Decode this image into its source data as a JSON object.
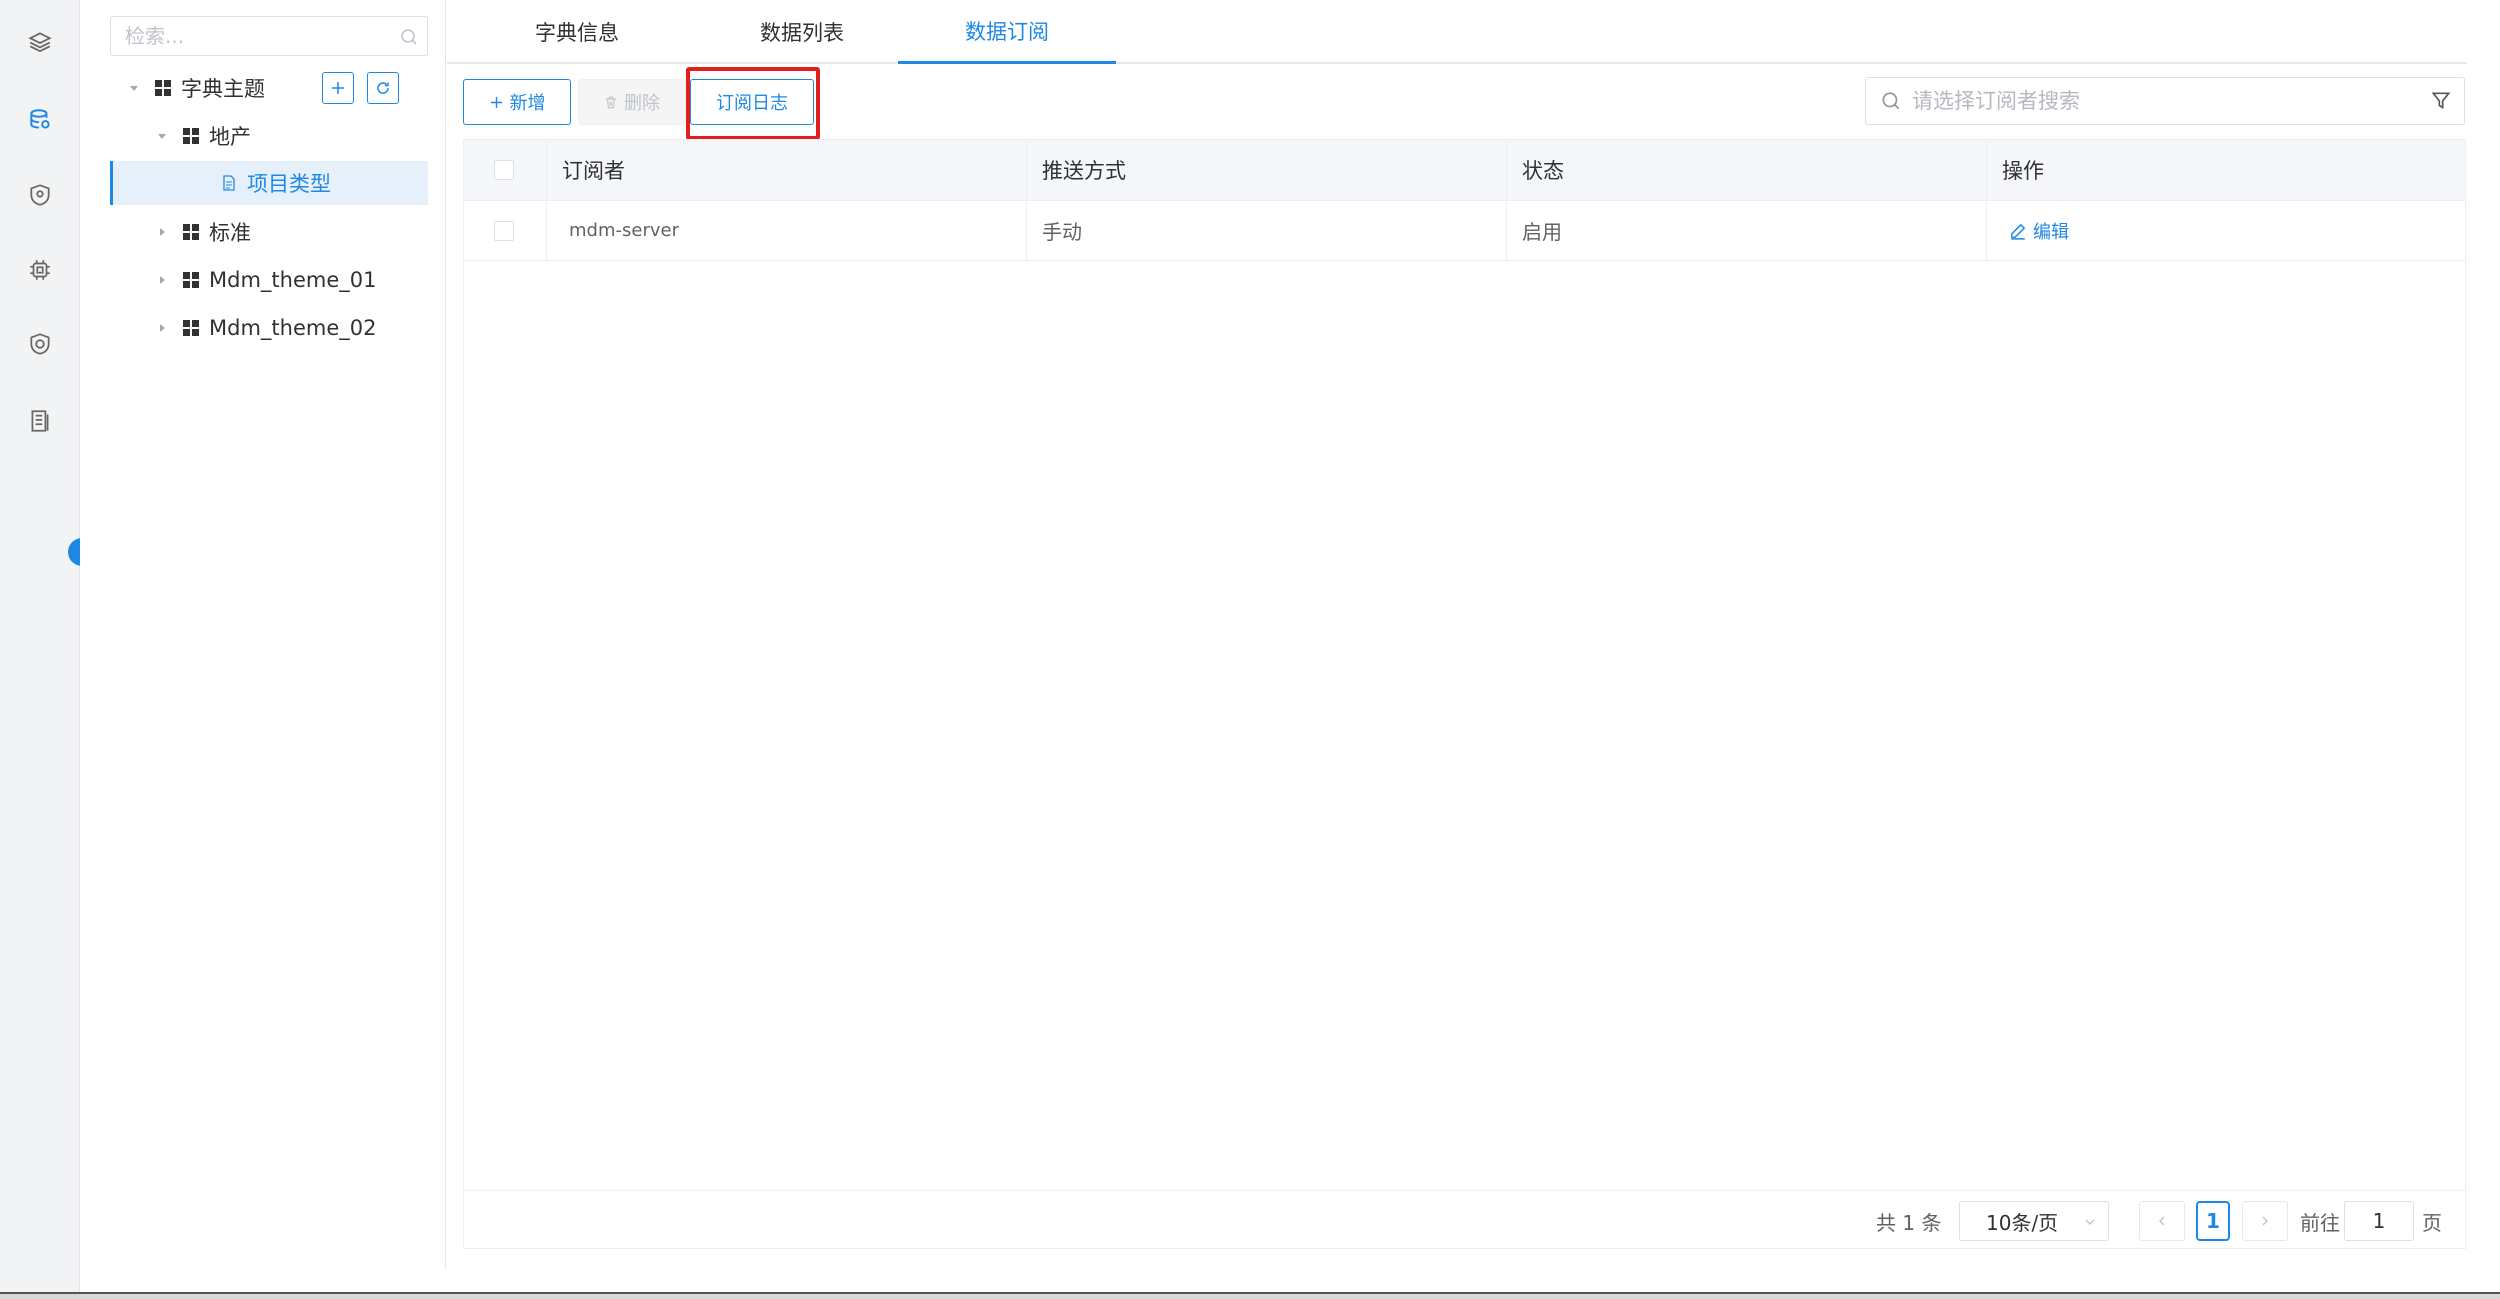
{
  "rail": {
    "icons": [
      "layers-icon",
      "database-icon",
      "shield-location-icon",
      "chip-icon",
      "shield-icon",
      "document-list-icon"
    ]
  },
  "tree": {
    "search_placeholder": "检索...",
    "root": "字典主题",
    "nodes": {
      "real_estate": "地产",
      "project_type": "项目类型",
      "standard": "标准",
      "theme1": "Mdm_theme_01",
      "theme2": "Mdm_theme_02"
    },
    "selected": "项目类型"
  },
  "tabs": [
    "字典信息",
    "数据列表",
    "数据订阅"
  ],
  "active_tab": "数据订阅",
  "toolbar": {
    "add_label": "新增",
    "delete_label": "删除",
    "log_label": "订阅日志",
    "search_placeholder": "请选择订阅者搜索"
  },
  "table": {
    "headers": [
      "订阅者",
      "推送方式",
      "状态",
      "操作"
    ],
    "rows": [
      {
        "subscriber": "mdm-server",
        "push_mode": "手动",
        "status": "启用",
        "action": "编辑"
      }
    ]
  },
  "pagination": {
    "total": "共 1 条",
    "page_size": "10条/页",
    "current_page": "1",
    "goto_label": "前往",
    "goto_value": "1",
    "page_suffix": "页"
  },
  "colors": {
    "accent": "#1e88e5",
    "highlight": "#e02020"
  }
}
